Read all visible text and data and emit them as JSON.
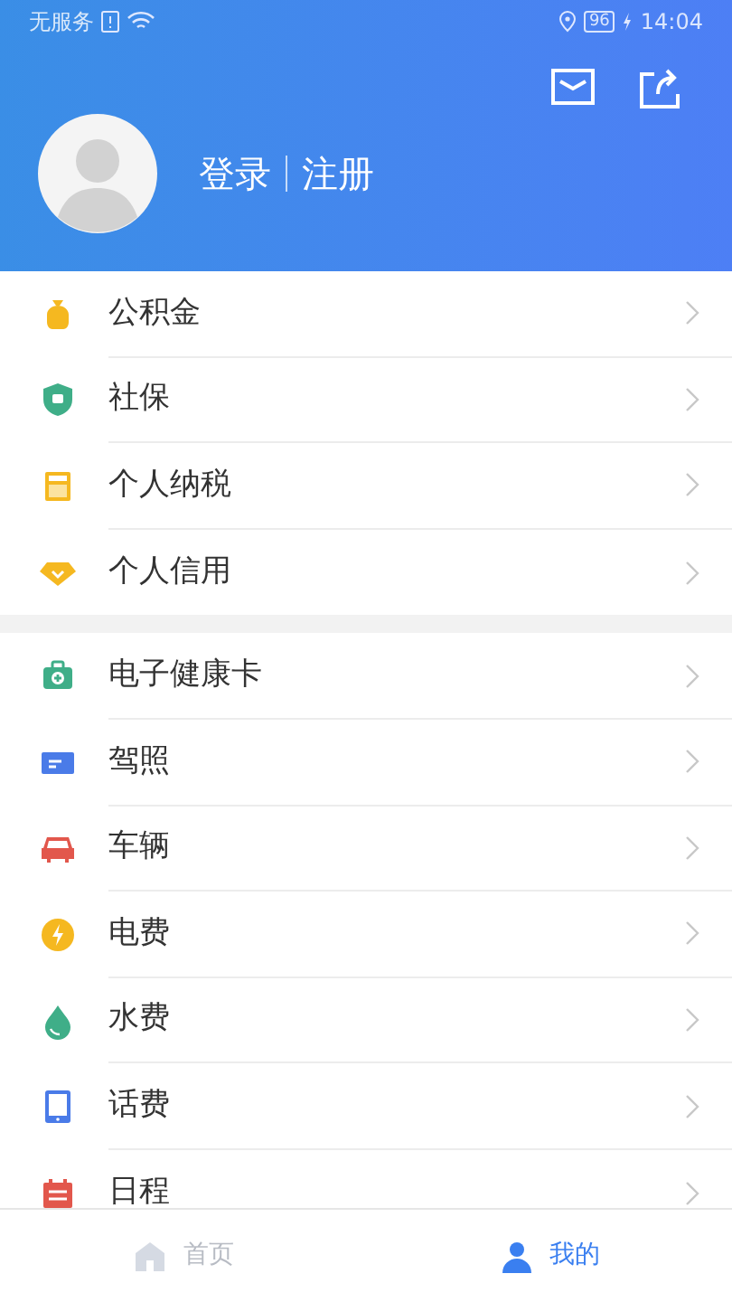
{
  "status_bar": {
    "carrier": "无服务",
    "battery": "96",
    "time": "14:04"
  },
  "header": {
    "login": "登录",
    "register": "注册"
  },
  "groups": [
    {
      "items": [
        {
          "label": "公积金"
        },
        {
          "label": "社保"
        },
        {
          "label": "个人纳税"
        },
        {
          "label": "个人信用"
        }
      ]
    },
    {
      "items": [
        {
          "label": "电子健康卡"
        },
        {
          "label": "驾照"
        },
        {
          "label": "车辆"
        },
        {
          "label": "电费"
        },
        {
          "label": "水费"
        },
        {
          "label": "话费"
        },
        {
          "label": "日程"
        }
      ]
    }
  ],
  "tab_bar": [
    {
      "label": "首页",
      "selected": false
    },
    {
      "label": "我的",
      "selected": true
    }
  ]
}
